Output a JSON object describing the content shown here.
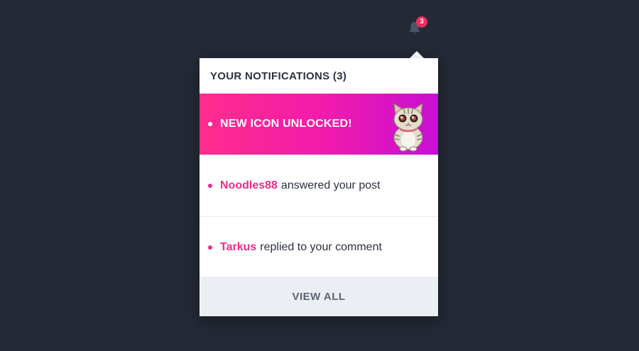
{
  "bell": {
    "icon": "bell-icon",
    "badge_count": "3",
    "badge_color": "#ee2c5e"
  },
  "dropdown": {
    "header": "YOUR NOTIFICATIONS (3)",
    "featured": {
      "text": "NEW ICON UNLOCKED!",
      "icon": "cat-icon"
    },
    "notifications": [
      {
        "user": "Noodles88",
        "action": "answered your post"
      },
      {
        "user": "Tarkus",
        "action": "replied to your comment"
      }
    ],
    "view_all": "VIEW ALL"
  },
  "colors": {
    "background": "#232935",
    "accent": "#ee2c8a",
    "gradient_start": "#ff2d8c",
    "gradient_end": "#c70fd4",
    "footer": "#ebeff3"
  }
}
